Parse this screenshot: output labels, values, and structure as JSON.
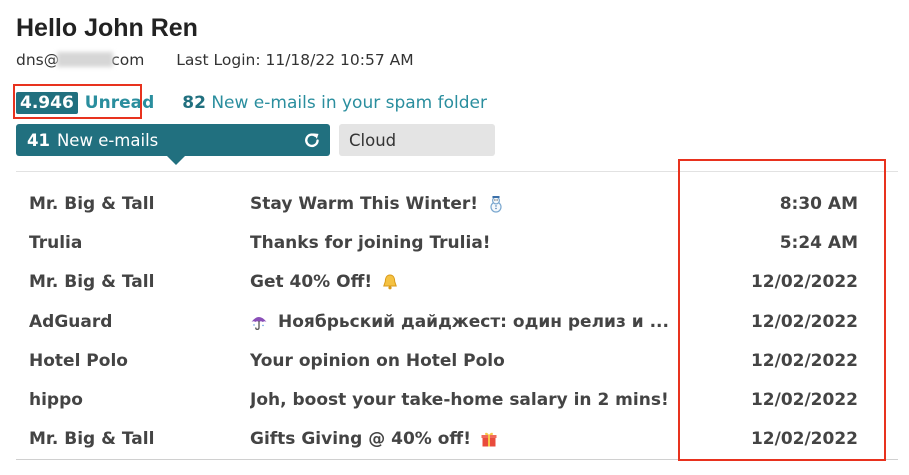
{
  "header": {
    "greeting": "Hello John Ren",
    "email_prefix": "dns@",
    "email_suffix": "com",
    "last_login": "Last Login: 11/18/22 10:57 AM"
  },
  "stats": {
    "unread_count": "4.946",
    "unread_label": "Unread",
    "spam_count": "82",
    "spam_text": "New e-mails in your spam folder"
  },
  "tabs": {
    "new_count": "41",
    "new_label": "New e-mails",
    "cloud_label": "Cloud"
  },
  "emails": [
    {
      "sender": "Mr. Big & Tall",
      "subject": "Stay Warm This Winter!",
      "emoji": "snowman-icon",
      "emoji_pos": "after",
      "date": "8:30 AM"
    },
    {
      "sender": "Trulia",
      "subject": "Thanks for joining Trulia!",
      "emoji": "",
      "emoji_pos": "",
      "date": "5:24 AM"
    },
    {
      "sender": "Mr. Big & Tall",
      "subject": "Get 40% Off!",
      "emoji": "bell-icon",
      "emoji_pos": "after",
      "date": "12/02/2022"
    },
    {
      "sender": "AdGuard",
      "subject": "Ноябрьский дайджест: один релиз и ...",
      "emoji": "umbrella-icon",
      "emoji_pos": "before",
      "date": "12/02/2022"
    },
    {
      "sender": "Hotel Polo",
      "subject": "Your opinion on Hotel Polo",
      "emoji": "",
      "emoji_pos": "",
      "date": "12/02/2022"
    },
    {
      "sender": "hippo",
      "subject": "Joh, boost your take-home salary in 2 mins!",
      "emoji": "",
      "emoji_pos": "",
      "date": "12/02/2022"
    },
    {
      "sender": "Mr. Big & Tall",
      "subject": "Gifts Giving @ 40% off!",
      "emoji": "gift-icon",
      "emoji_pos": "after",
      "date": "12/02/2022"
    }
  ],
  "colors": {
    "accent": "#21707f",
    "link": "#2a8e9e",
    "annotation": "#e8321e"
  }
}
